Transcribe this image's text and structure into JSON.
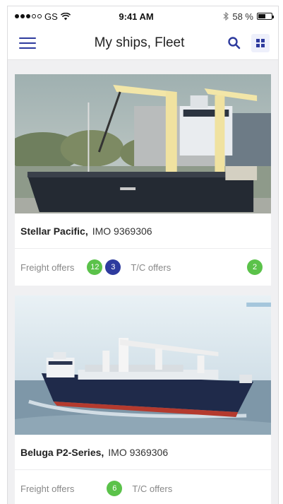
{
  "status_bar": {
    "carrier": "GS",
    "time": "9:41 AM",
    "battery": "58 %",
    "battery_level": 0.58
  },
  "nav": {
    "title": "My ships, Fleet"
  },
  "ships": [
    {
      "name": "Stellar Pacific,",
      "imo": "IMO 9369306",
      "freight_label": "Freight offers",
      "freight_count_green": "12",
      "freight_count_blue": "3",
      "tc_label": "T/C offers",
      "tc_count": "2"
    },
    {
      "name": "Beluga P2-Series,",
      "imo": "IMO 9369306",
      "freight_label": "Freight offers",
      "freight_count_green": "6",
      "tc_label": "T/C offers"
    }
  ],
  "colors": {
    "accent": "#2e3b9e",
    "badge_green": "#5bc24a"
  }
}
